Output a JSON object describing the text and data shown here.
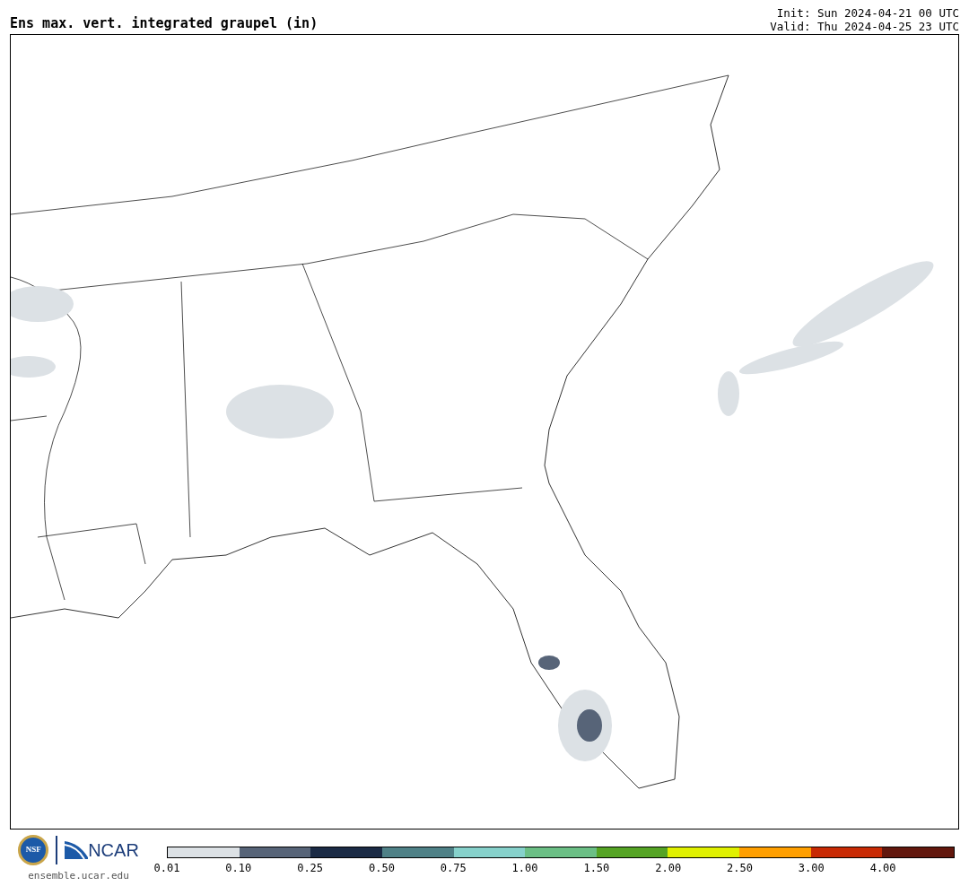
{
  "title": "Ens max. vert. integrated graupel (in)",
  "init": "Init: Sun 2024-04-21 00 UTC",
  "valid": "Valid: Thu 2024-04-25 23 UTC",
  "logo": {
    "nsf": "NSF",
    "ncar": "NCAR"
  },
  "url": "ensemble.ucar.edu",
  "colorbar": {
    "segments": [
      {
        "color": "#dce1e5"
      },
      {
        "color": "#576478"
      },
      {
        "color": "#1b2b45"
      },
      {
        "color": "#4f8187"
      },
      {
        "color": "#86d1cb"
      },
      {
        "color": "#6bbf85"
      },
      {
        "color": "#55a424"
      },
      {
        "color": "#e0f000"
      },
      {
        "color": "#ff9f00"
      },
      {
        "color": "#c82a04"
      },
      {
        "color": "#62170d"
      }
    ],
    "labels": [
      "0.01",
      "0.10",
      "0.25",
      "0.50",
      "0.75",
      "1.00",
      "1.50",
      "2.00",
      "2.50",
      "3.00",
      "4.00"
    ]
  }
}
